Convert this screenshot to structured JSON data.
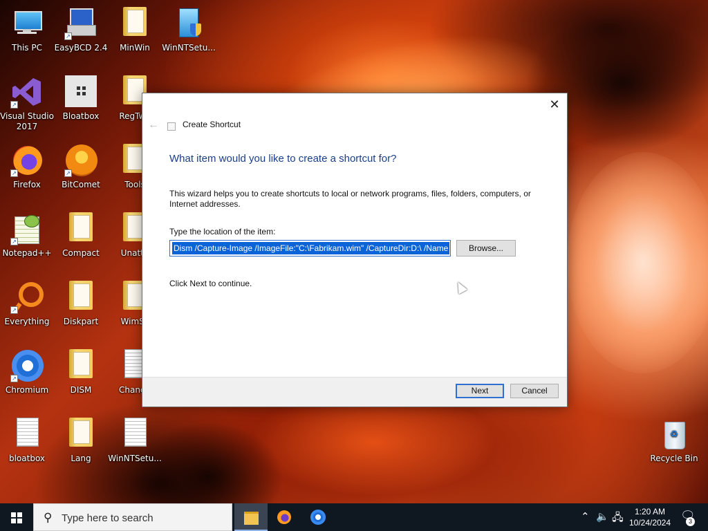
{
  "desktop": {
    "icons": [
      {
        "label": "This PC",
        "kind": "pc"
      },
      {
        "label": "EasyBCD 2.4",
        "kind": "easybcd"
      },
      {
        "label": "MinWin",
        "kind": "folder"
      },
      {
        "label": "WinNTSetu...",
        "kind": "setup"
      },
      {
        "label": "Visual Studio 2017",
        "line1": "Visual Studio",
        "line2": "2017",
        "kind": "vs"
      },
      {
        "label": "Bloatbox",
        "kind": "bloatbox"
      },
      {
        "label": "RegTwe",
        "kind": "folder"
      },
      {
        "label": "Firefox",
        "kind": "firefox"
      },
      {
        "label": "BitComet",
        "kind": "bitcomet"
      },
      {
        "label": "Tools",
        "kind": "folder"
      },
      {
        "label": "Notepad++",
        "kind": "notepadpp"
      },
      {
        "label": "Compact",
        "kind": "folder"
      },
      {
        "label": "Unatte",
        "kind": "folder"
      },
      {
        "label": "Everything",
        "kind": "everything"
      },
      {
        "label": "Diskpart",
        "kind": "folder"
      },
      {
        "label": "WimSc",
        "kind": "folder"
      },
      {
        "label": "Chromium",
        "kind": "chromium"
      },
      {
        "label": "DISM",
        "kind": "folder"
      },
      {
        "label": "Change",
        "kind": "doc"
      },
      {
        "label": "bloatbox",
        "kind": "doc"
      },
      {
        "label": "Lang",
        "kind": "folder"
      },
      {
        "label": "WinNTSetu...",
        "kind": "doc"
      },
      {
        "label": "Recycle Bin",
        "kind": "recycle"
      }
    ]
  },
  "dialog": {
    "title": "Create Shortcut",
    "heading": "What item would you like to create a shortcut for?",
    "description": "This wizard helps you to create shortcuts to local or network programs, files, folders, computers, or Internet addresses.",
    "location_label": "Type the location of the item:",
    "location_value": "Dism /Capture-Image /ImageFile:\"C:\\Fabrikam.wim\" /CaptureDir:D:\\ /Name",
    "browse_label": "Browse...",
    "continue_text": "Click Next to continue.",
    "next_label": "Next",
    "cancel_label": "Cancel",
    "close_glyph": "✕",
    "back_glyph": "←"
  },
  "taskbar": {
    "search_placeholder": "Type here to search",
    "apps": [
      "file-explorer",
      "firefox",
      "chromium"
    ],
    "time": "1:20 AM",
    "date": "10/24/2024",
    "notification_count": "3"
  }
}
